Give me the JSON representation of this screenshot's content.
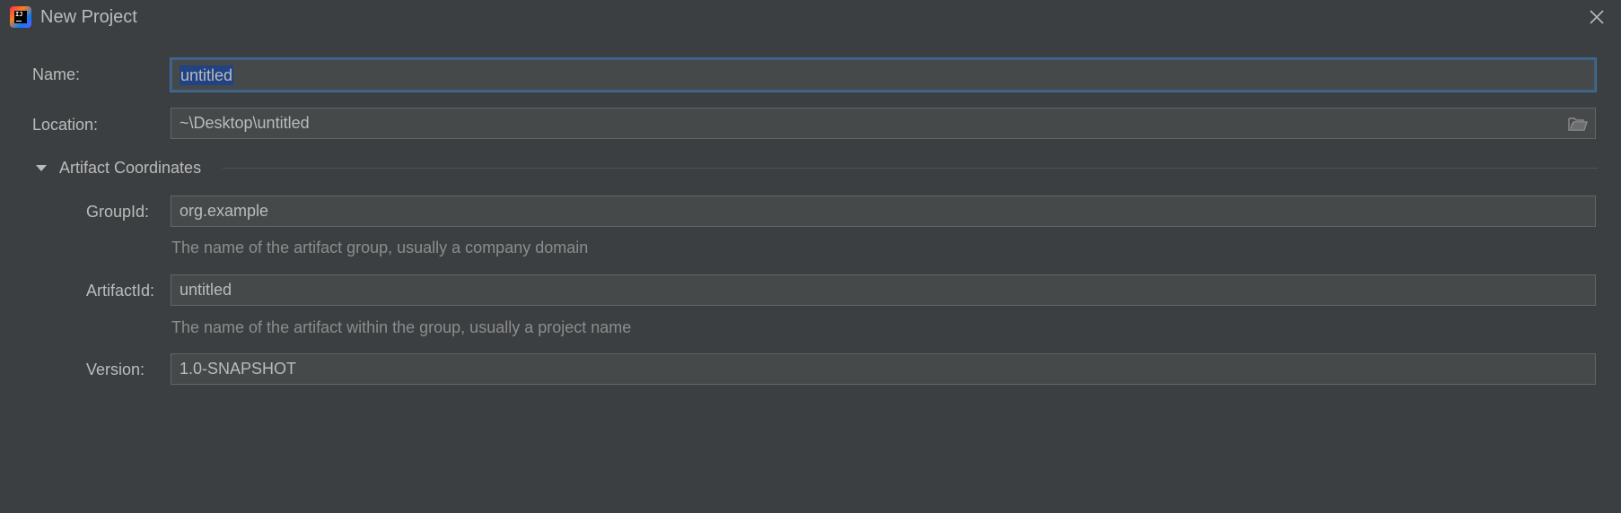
{
  "window": {
    "title": "New Project",
    "app_icon": "intellij-idea-icon",
    "close_icon": "close-icon"
  },
  "form": {
    "name": {
      "label": "Name:",
      "value": "untitled"
    },
    "location": {
      "label": "Location:",
      "value": "~\\Desktop\\untitled",
      "browse_icon": "folder-open-icon"
    }
  },
  "artifact_coordinates": {
    "section_label": "Artifact Coordinates",
    "expanded": true,
    "group_id": {
      "label": "GroupId:",
      "value": "org.example",
      "hint": "The name of the artifact group, usually a company domain"
    },
    "artifact_id": {
      "label": "ArtifactId:",
      "value": "untitled",
      "hint": "The name of the artifact within the group, usually a project name"
    },
    "version": {
      "label": "Version:",
      "value": "1.0-SNAPSHOT"
    }
  },
  "colors": {
    "background": "#3c3f41",
    "field_background": "#45494a",
    "field_border": "#646464",
    "focus_border": "#3d6185",
    "selection": "#214283",
    "text": "#bbbbbb",
    "hint_text": "#8c8c8c"
  }
}
